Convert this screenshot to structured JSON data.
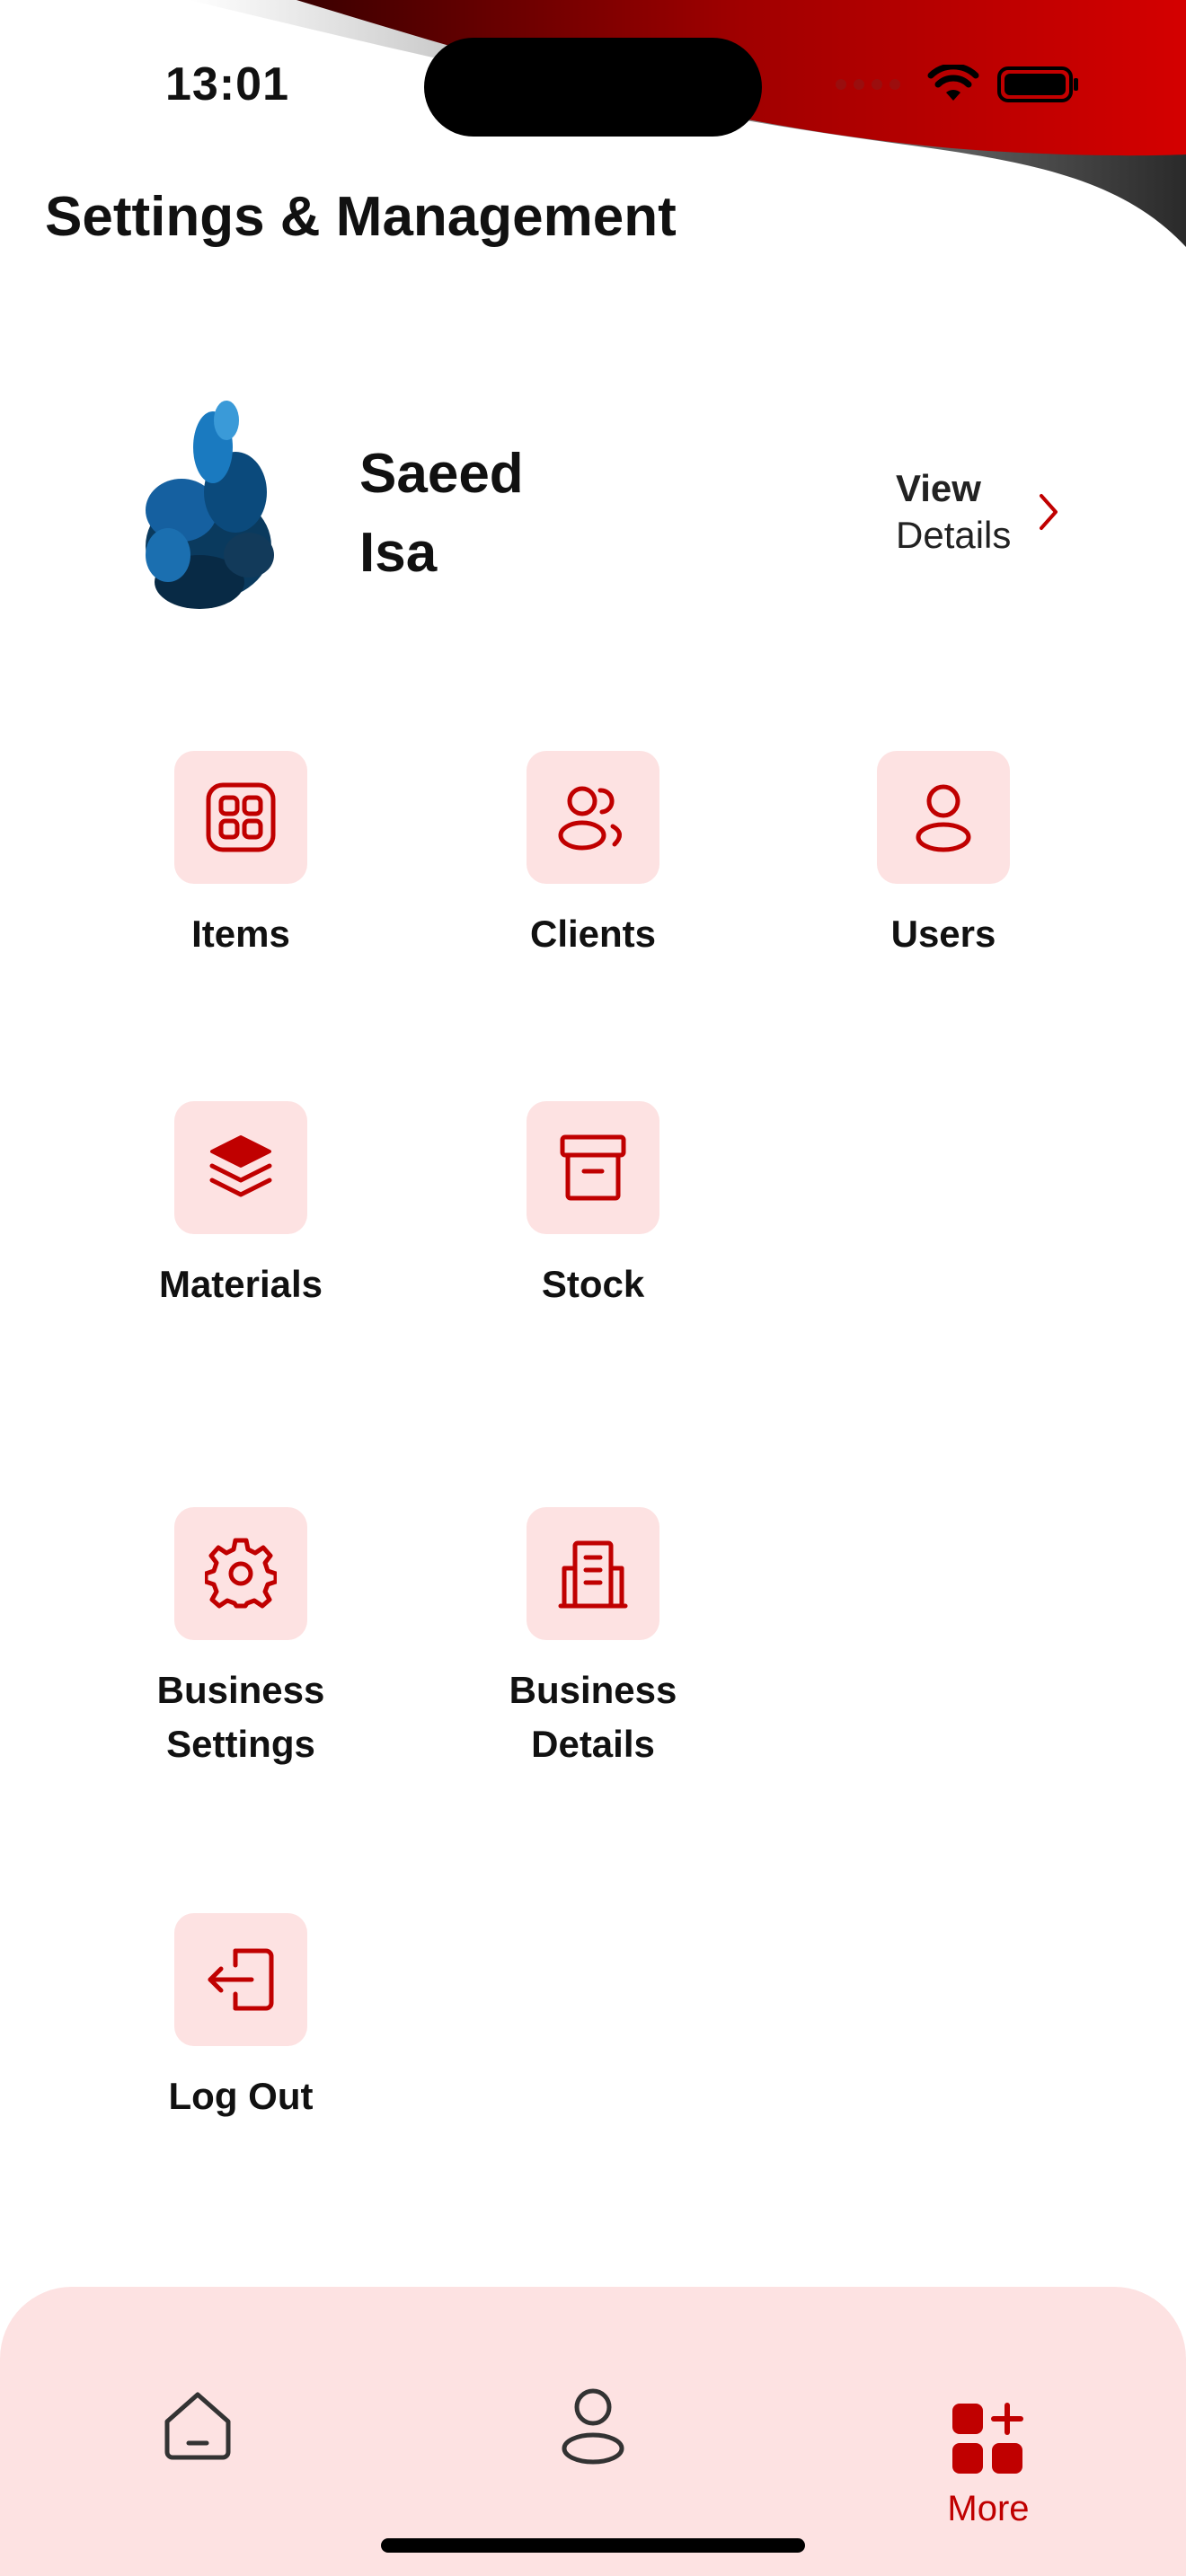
{
  "status_bar": {
    "time": "13:01"
  },
  "header": {
    "title": "Settings & Management"
  },
  "profile": {
    "first_name": "Saeed",
    "last_name": "Isa",
    "view_label": "View",
    "details_label": "Details"
  },
  "menu": {
    "items": {
      "label": "Items"
    },
    "clients": {
      "label": "Clients"
    },
    "users": {
      "label": "Users"
    },
    "materials": {
      "label": "Materials"
    },
    "stock": {
      "label": "Stock"
    },
    "business_settings": {
      "line1": "Business",
      "line2": "Settings"
    },
    "business_details": {
      "line1": "Business",
      "line2": "Details"
    },
    "log_out": {
      "label": "Log Out"
    }
  },
  "bottom_nav": {
    "more_label": "More",
    "active_tab": "More"
  },
  "colors": {
    "accent": "#c00000",
    "tile_background": "#fde2e2",
    "nav_background": "#fde2e2"
  }
}
